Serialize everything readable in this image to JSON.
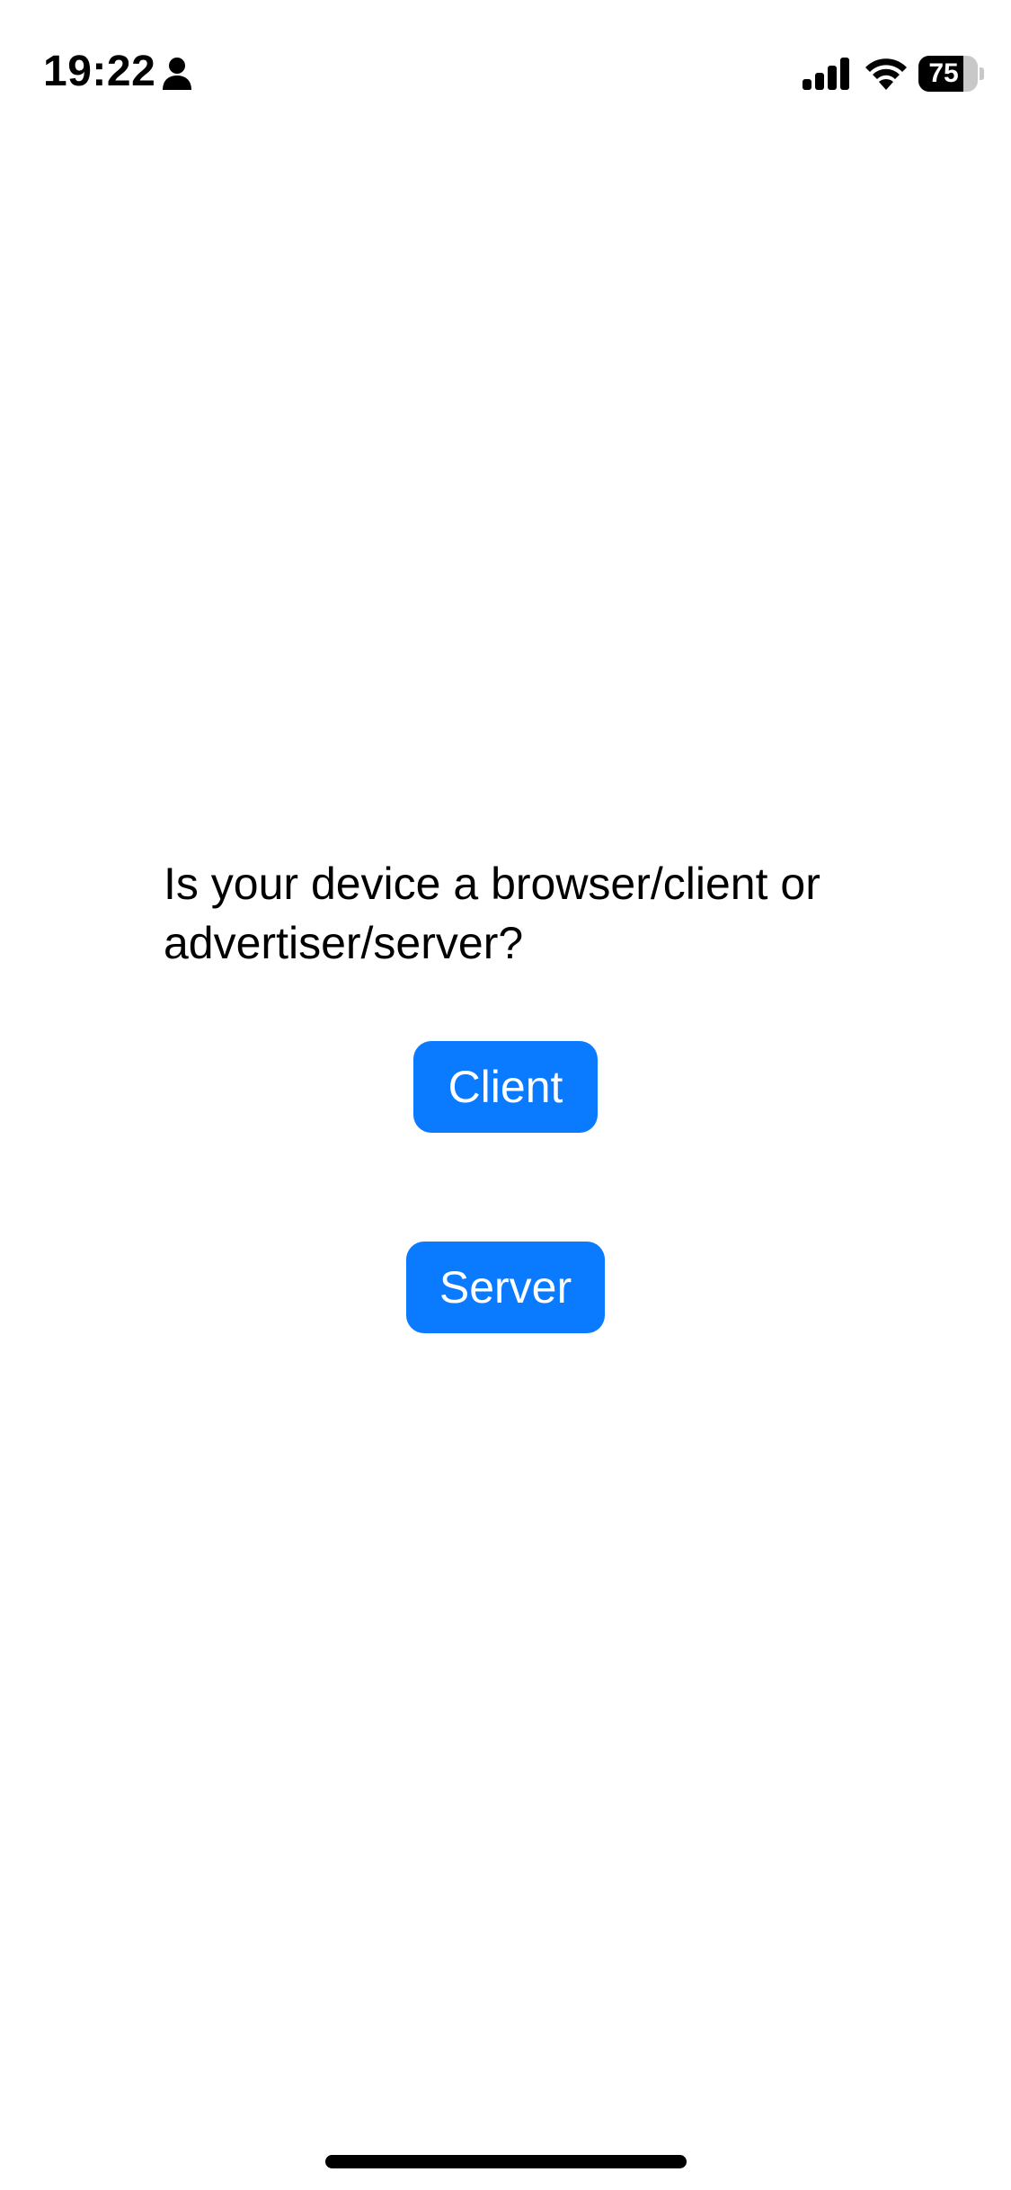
{
  "status_bar": {
    "time": "19:22",
    "battery_percent": 75,
    "battery_label": "75",
    "icons": [
      "person-icon",
      "cellular-signal-icon",
      "wifi-icon",
      "battery-icon"
    ]
  },
  "prompt": {
    "question": "Is your device a browser/client or advertiser/server?"
  },
  "buttons": {
    "client_label": "Client",
    "server_label": "Server"
  },
  "colors": {
    "accent": "#0a7aff",
    "background": "#ffffff",
    "text": "#000000"
  }
}
